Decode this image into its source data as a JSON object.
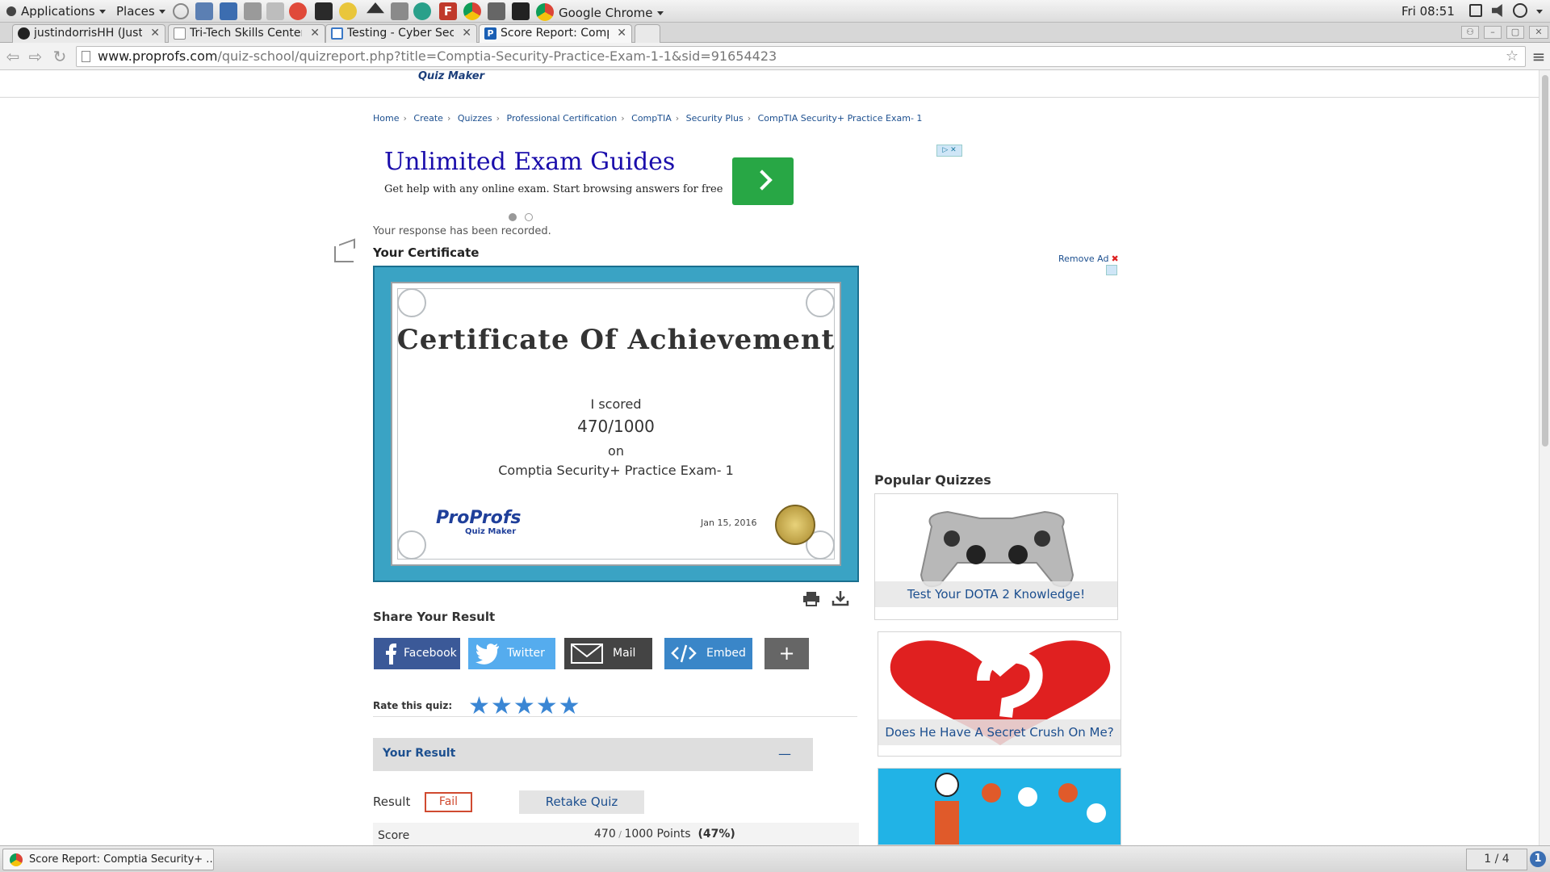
{
  "gnome_panel": {
    "applications": "Applications",
    "places": "Places",
    "active_app": "Google Chrome",
    "clock": "Fri 08:51"
  },
  "tabs": [
    {
      "title": "justindorrisHH (Justin",
      "icon": "github-icon"
    },
    {
      "title": "Tri-Tech Skills Center",
      "icon": "page-icon"
    },
    {
      "title": "Testing - Cyber Secu",
      "icon": "doc-icon"
    },
    {
      "title": "Score Report: Compt",
      "icon": "proprofs-icon"
    }
  ],
  "toolbar": {
    "url_host": "www.proprofs.com",
    "url_path": "/quiz-school/quizreport.php?title=Comptia-Security-Practice-Exam-1-1&sid=91654423"
  },
  "header": {
    "logo_sub": "Quiz Maker"
  },
  "breadcrumb": [
    "Home",
    "Create",
    "Quizzes",
    "Professional Certification",
    "CompTIA",
    "Security Plus",
    "CompTIA Security+ Practice Exam- 1"
  ],
  "ad": {
    "title": "Unlimited Exam Guides",
    "subtitle": "Get help with any online exam. Start browsing answers for free"
  },
  "status": {
    "recorded": "Your response has been recorded."
  },
  "certificate": {
    "label": "Your Certificate",
    "title": "Certificate Of Achievement",
    "scored": "I scored",
    "score": "470/1000",
    "on": "on",
    "quiz": "Comptia Security+ Practice Exam- 1",
    "logo": "ProProfs",
    "logo_sub": "Quiz Maker",
    "date": "Jan 15, 2016"
  },
  "share": {
    "heading": "Share Your Result",
    "facebook": "Facebook",
    "twitter": "Twitter",
    "mail": "Mail",
    "embed": "Embed",
    "more": "+"
  },
  "rating": {
    "label": "Rate this quiz:",
    "stars_shown": 5,
    "stars_max": 5
  },
  "result": {
    "section_title": "Your Result",
    "collapse": "—",
    "result_label": "Result",
    "result_value": "Fail",
    "retake": "Retake Quiz",
    "score_label": "Score",
    "score_points": "470",
    "score_total": "1000 Points",
    "score_percent": "(47%)"
  },
  "sidebar": {
    "remove_ad": "Remove Ad",
    "popular_heading": "Popular Quizzes",
    "quizzes": [
      {
        "title": "Test Your DOTA 2 Knowledge!"
      },
      {
        "title": "Does He Have A Secret Crush On Me?"
      }
    ]
  },
  "taskbar": {
    "window_title": "Score Report: Comptia Security+ ...",
    "workspace": "1 / 4",
    "notification": "1"
  },
  "colors": {
    "link": "#1c4f8f",
    "facebook": "#3b5998",
    "twitter": "#55acee",
    "mail": "#444444",
    "embed": "#3a86c8",
    "fail": "#d04a30",
    "star": "#3a86d4",
    "ad_button": "#28a745"
  }
}
